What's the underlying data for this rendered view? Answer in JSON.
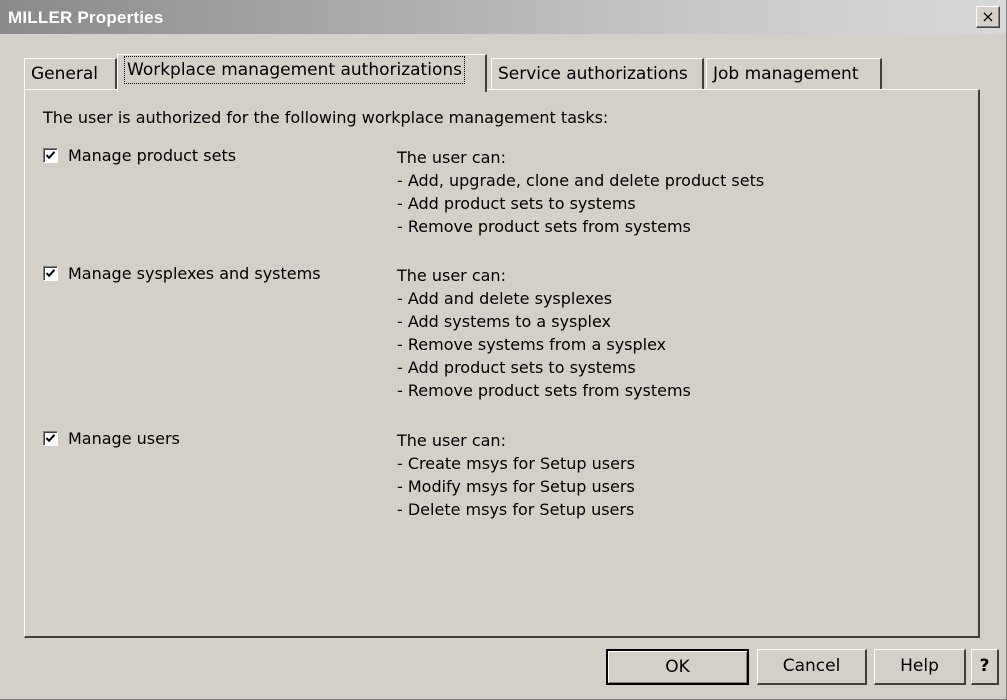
{
  "window": {
    "title": "MILLER Properties",
    "close_glyph": "×"
  },
  "tabs": [
    {
      "label": "General",
      "active": false
    },
    {
      "label": "Workplace management authorizations",
      "active": true
    },
    {
      "label": "Service authorizations",
      "active": false
    },
    {
      "label": "Job management",
      "active": false
    }
  ],
  "panel": {
    "intro": "The user is authorized for the following workplace management tasks:",
    "permissions": [
      {
        "label": "Manage product sets",
        "checked": true,
        "description": [
          "The user can:",
          "- Add, upgrade, clone and delete product sets",
          "- Add product sets to systems",
          "- Remove product sets from systems"
        ]
      },
      {
        "label": "Manage sysplexes and systems",
        "checked": true,
        "description": [
          "The user can:",
          "- Add and delete sysplexes",
          "- Add systems to a sysplex",
          "- Remove systems from a sysplex",
          "- Add product sets to systems",
          "- Remove product sets from systems"
        ]
      },
      {
        "label": "Manage users",
        "checked": true,
        "description": [
          "The user can:",
          "- Create msys for Setup users",
          "- Modify msys for Setup users",
          "- Delete msys for Setup users"
        ]
      }
    ]
  },
  "buttons": {
    "ok": "OK",
    "cancel": "Cancel",
    "help": "Help",
    "whats_this": "?"
  },
  "colors": {
    "face": "#d4d0c8",
    "title_text": "#ffffff"
  }
}
